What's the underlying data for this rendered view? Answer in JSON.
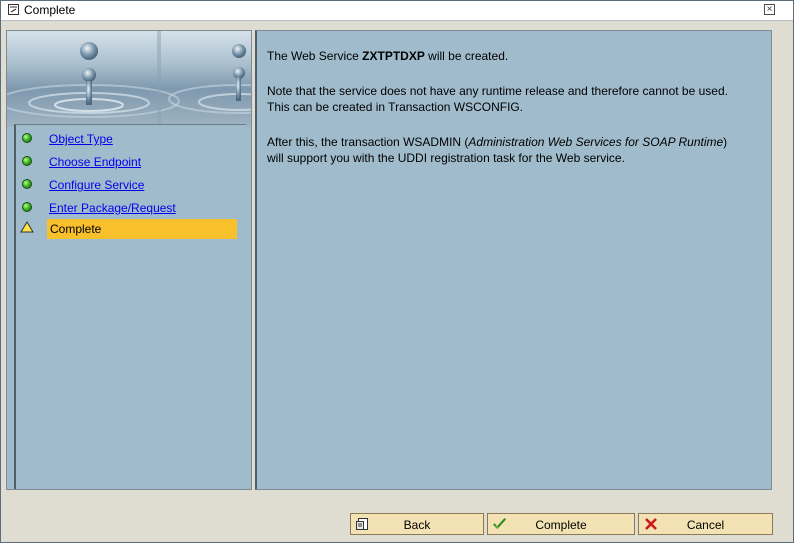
{
  "window": {
    "title": "Complete",
    "close_label": "×"
  },
  "steps": [
    {
      "label": "Object Type",
      "status": "done"
    },
    {
      "label": "Choose Endpoint",
      "status": "done"
    },
    {
      "label": "Configure Service",
      "status": "done"
    },
    {
      "label": "Enter Package/Request",
      "status": "done"
    },
    {
      "label": "Complete",
      "status": "current"
    }
  ],
  "content": {
    "p1_prefix": "The Web Service ",
    "p1_name": "ZXTPTDXP",
    "p1_suffix": " will be created.",
    "p2": "Note that the service does not have any runtime release and therefore cannot be used. This can be created in Transaction WSCONFIG.",
    "p3_prefix": "After this, the transaction WSADMIN (",
    "p3_italic": "Administration Web Services for SOAP Runtime",
    "p3_suffix": ") will support you with the UDDI registration task for the Web service."
  },
  "buttons": {
    "back": "Back",
    "complete": "Complete",
    "cancel": "Cancel"
  },
  "colors": {
    "panel_bg": "#a0bccc",
    "highlight": "#f8c12b",
    "button_bg": "#f3e3b4",
    "link": "#0000ee"
  },
  "icons": {
    "title": "window-icon",
    "done_step": "green-dot-icon",
    "current_step": "yellow-triangle-icon",
    "back": "back-page-icon",
    "complete": "checkmark-icon",
    "cancel": "red-x-icon"
  }
}
